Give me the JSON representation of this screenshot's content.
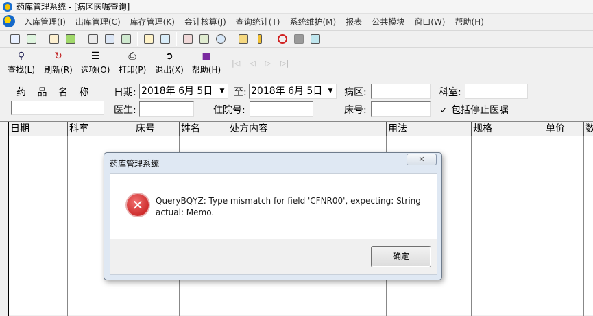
{
  "window": {
    "title": "药库管理系统 - [病区医嘱查询]"
  },
  "menu": [
    "入库管理(I)",
    "出库管理(C)",
    "库存管理(K)",
    "会计核算(J)",
    "查询统计(T)",
    "系统维护(M)",
    "报表",
    "公共模块",
    "窗口(W)",
    "帮助(H)"
  ],
  "toolbar_buttons": [
    {
      "label": "查找(L)",
      "icon": "magnifier-icon"
    },
    {
      "label": "刷新(R)",
      "icon": "refresh-icon"
    },
    {
      "label": "选项(O)",
      "icon": "options-icon"
    },
    {
      "label": "打印(P)",
      "icon": "printer-icon"
    },
    {
      "label": "退出(X)",
      "icon": "exit-icon"
    },
    {
      "label": "帮助(H)",
      "icon": "help-book-icon"
    }
  ],
  "filters": {
    "drug_name_label": "药 品 名 称",
    "drug_name_value": "",
    "date_label": "日期:",
    "date_from": "2018年 6月 5日",
    "to_label": "至:",
    "date_to": "2018年 6月 5日",
    "ward_label": "病区:",
    "ward_value": "",
    "dept_label": "科室:",
    "dept_value": "",
    "doctor_label": "医生:",
    "doctor_value": "",
    "inpatient_label": "住院号:",
    "inpatient_value": "",
    "bed_label": "床号:",
    "bed_value": "",
    "include_stopped_label": "包括停止医嘱",
    "include_stopped_checked": true
  },
  "grid": {
    "columns": [
      "日期",
      "科室",
      "床号",
      "姓名",
      "处方内容",
      "用法",
      "规格",
      "单价",
      "数"
    ]
  },
  "dialog": {
    "title": "药库管理系统",
    "close": "✕",
    "message": "QueryBQYZ: Type mismatch for field 'CFNR00', expecting: String actual: Memo.",
    "ok_label": "确定"
  }
}
